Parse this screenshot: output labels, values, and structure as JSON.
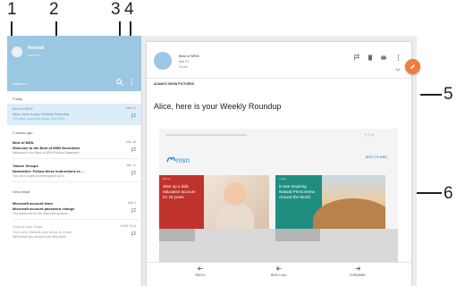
{
  "callouts": [
    "1",
    "2",
    "3",
    "4",
    "5",
    "6"
  ],
  "account": {
    "name": "Hotmail",
    "subtitle": "Inbox 8"
  },
  "folder": {
    "label": "Outbox"
  },
  "list": {
    "sections": [
      "Friday",
      "2 weeks ago",
      "View email"
    ],
    "emails": [
      {
        "sender": "Best of MSN",
        "subject": "Alice, here is your Weekly Roundup",
        "preview": "The week news and trends from MSN",
        "date": "Mar 27",
        "selected": true
      },
      {
        "sender": "Best of MSN",
        "subject": "Welcome to the Best of MSN Newsletter",
        "preview": "Welcome to the Best of MSN Privacy Statement",
        "date": "Mar 16",
        "selected": false
      },
      {
        "sender": "Yahoo! Groups",
        "subject": "Newsletter: Follow these instructions to ...",
        "preview": "You can not get yourself signed up to ...",
        "date": "Mar 11",
        "selected": false
      },
      {
        "sender": "Microsoft account team",
        "subject": "Microsoft account password change",
        "preview": "The password for the Microsoft account ...",
        "date": "Mar 2",
        "selected": false
      },
      {
        "sender": "Outlook.com Team",
        "subject": "Your new Outlook.com inbox is ready",
        "preview": "We'll show you around your new inbox ...",
        "date": "12/16 2014",
        "selected": false
      }
    ]
  },
  "reading": {
    "from_name": "Best of MSN",
    "from_date": "Mar 27",
    "to": "To me",
    "show_pictures": "ALWAYS SHOW PICTURES",
    "greeting": "Alice, here is your Weekly Roundup",
    "newsletter": {
      "logo": "msn",
      "link": "BEST OF MSN",
      "card1_label": "Money",
      "card1_text": "Start up a kids education account for 18 years",
      "card2_label": "Travel",
      "card2_text": "8 Awe-Inspiring Natural Phenomena Around the World"
    },
    "actions": [
      "REPLY",
      "REPLY ALL",
      "FORWARD"
    ]
  },
  "colors": {
    "header": "#9cc7e2",
    "selected_row": "#dcedf7",
    "fab": "#ef7d3c",
    "card_red": "#c0322c",
    "card_teal": "#1f8e80"
  },
  "icons": {
    "fab": "pencil-icon",
    "search": "search-icon",
    "menu": "more-vert-icon"
  }
}
